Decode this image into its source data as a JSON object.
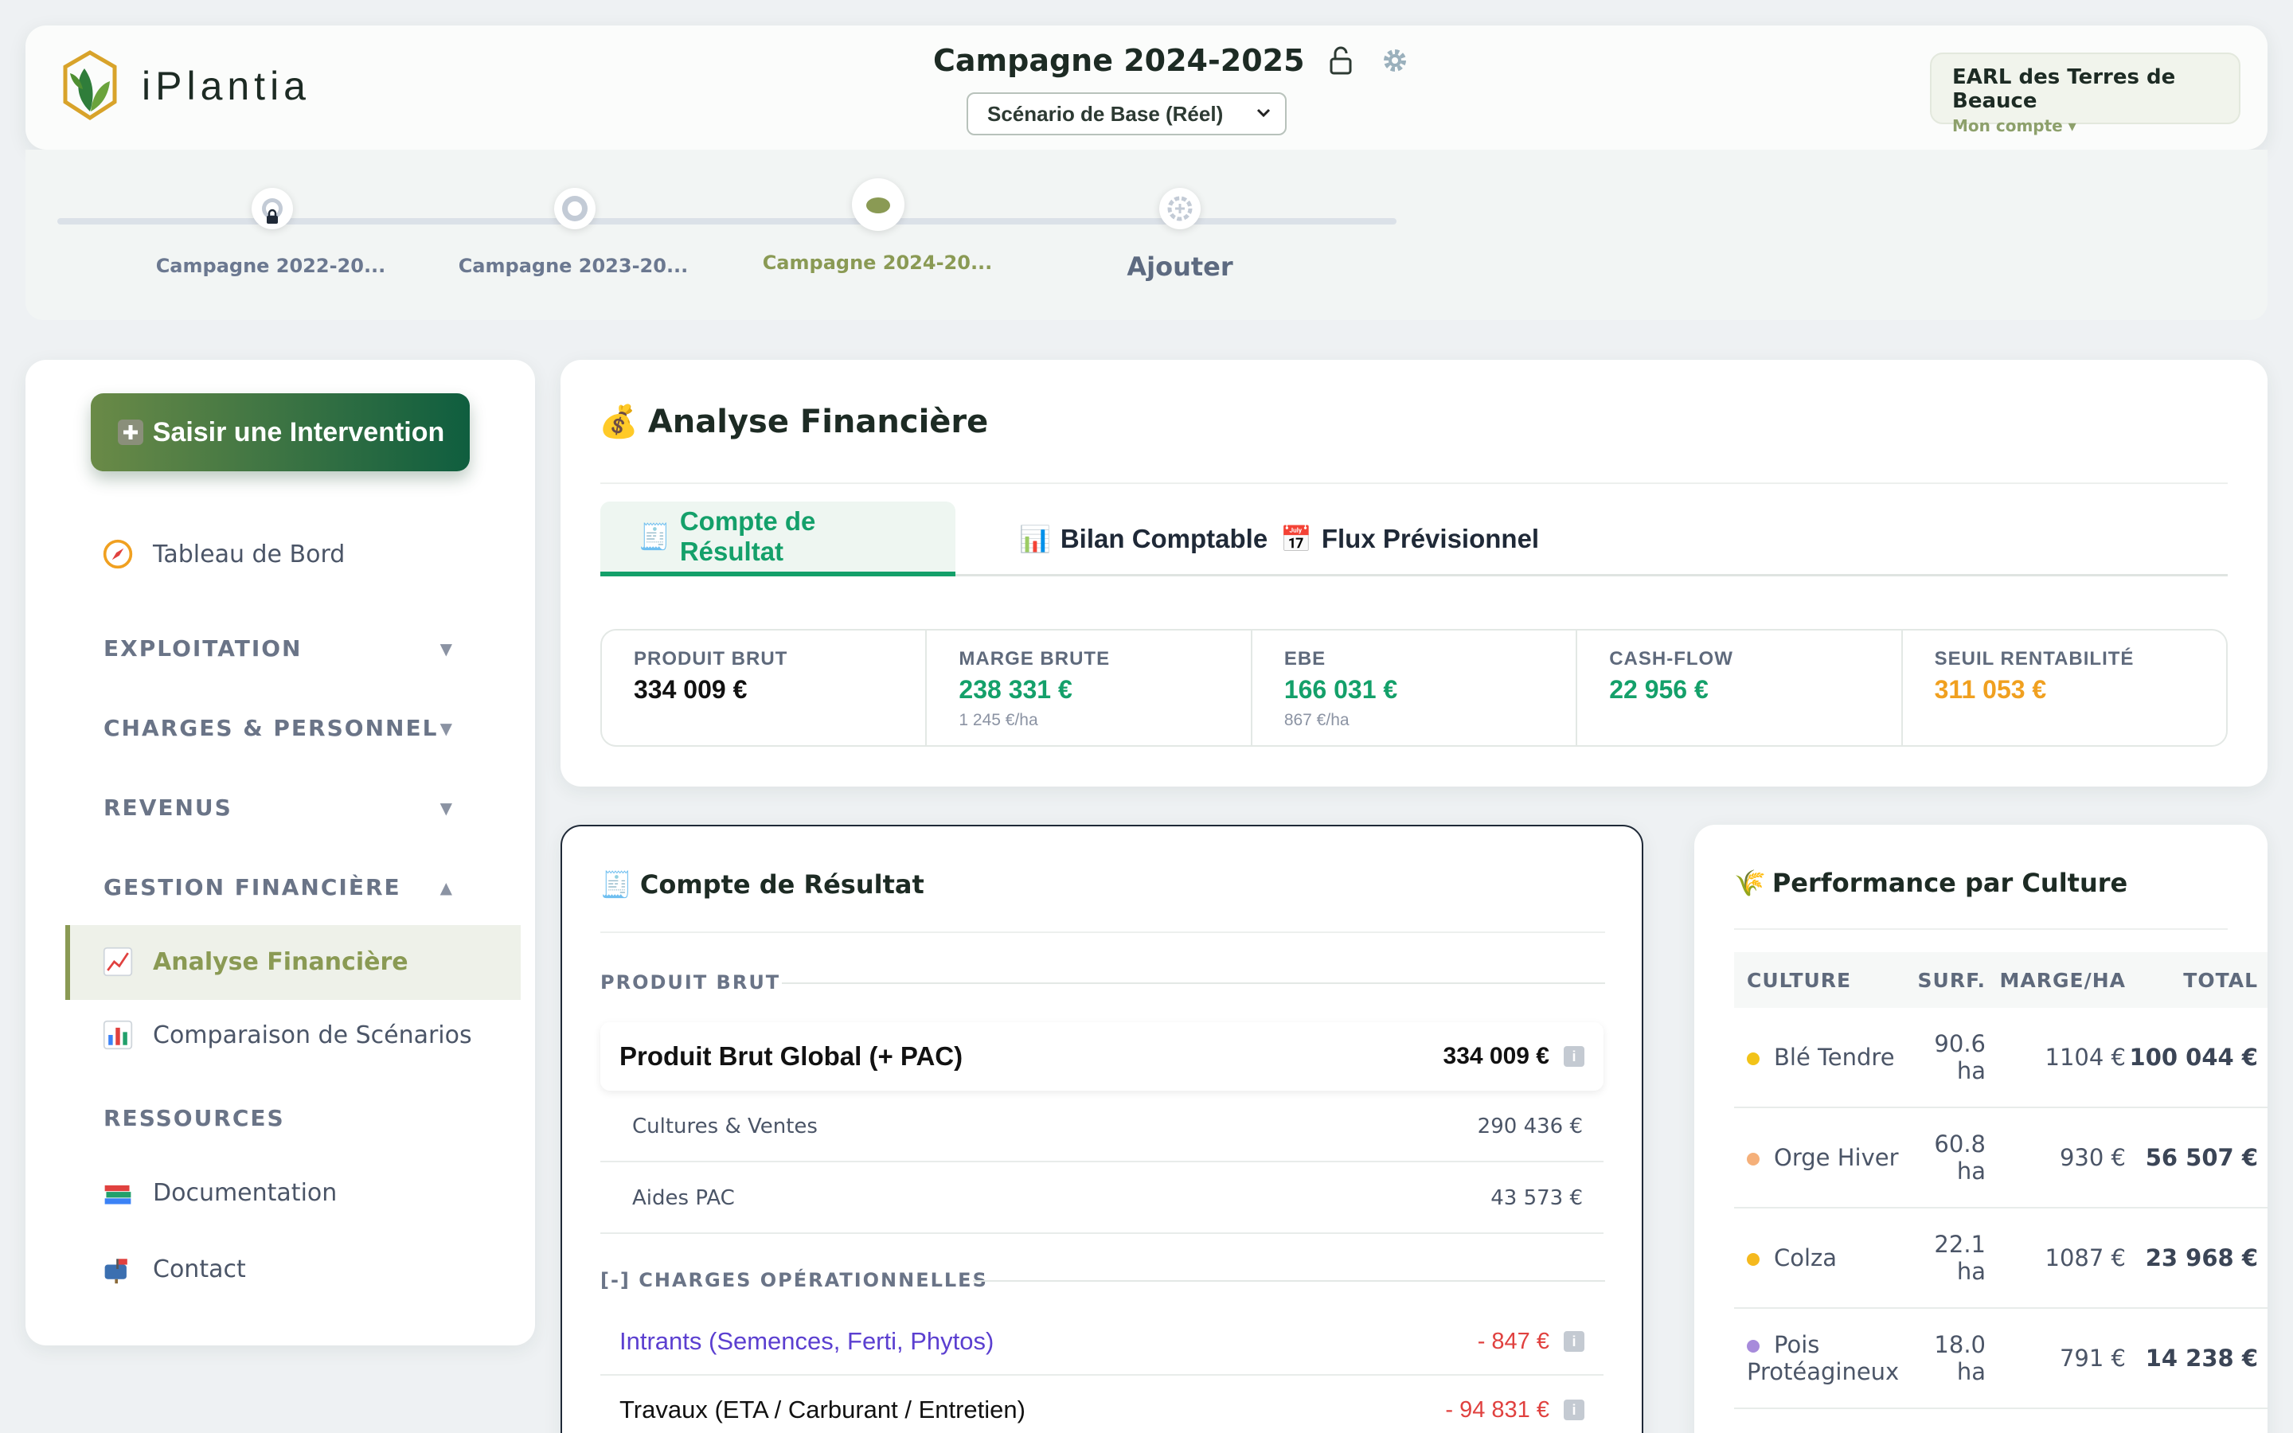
{
  "header": {
    "app_name": "iPlantia",
    "campaign_title": "Campagne 2024-2025",
    "scenario_selected": "Scénario de Base (Réel)",
    "account_name": "EARL des Terres de Beauce",
    "account_link": "Mon compte ▾"
  },
  "timeline": {
    "items": [
      {
        "label": "Campagne 2022-20..."
      },
      {
        "label": "Campagne 2023-20..."
      },
      {
        "label": "Campagne 2024-20..."
      },
      {
        "label": "Ajouter"
      }
    ]
  },
  "sidebar": {
    "cta_label": "Saisir une Intervention",
    "dashboard": "Tableau de Bord",
    "sections": [
      {
        "label": "EXPLOITATION",
        "arrow": "▼"
      },
      {
        "label": "CHARGES & PERSONNEL",
        "arrow": "▼"
      },
      {
        "label": "REVENUS",
        "arrow": "▼"
      },
      {
        "label": "GESTION FINANCIÈRE",
        "arrow": "▲"
      },
      {
        "label": "RESSOURCES"
      }
    ],
    "items": [
      {
        "label": "Analyse Financière"
      },
      {
        "label": "Comparaison de Scénarios"
      },
      {
        "label": "Documentation"
      },
      {
        "label": "Contact"
      }
    ]
  },
  "analysis": {
    "title": "Analyse Financière",
    "tabs": [
      {
        "label": "Compte de Résultat"
      },
      {
        "label": "Bilan Comptable"
      },
      {
        "label": "Flux Prévisionnel"
      }
    ],
    "kpis": [
      {
        "label": "PRODUIT BRUT",
        "value": "334 009 €",
        "sub": "",
        "color": "#111111"
      },
      {
        "label": "MARGE BRUTE",
        "value": "238 331 €",
        "sub": "1 245 €/ha",
        "color": "#14a06a"
      },
      {
        "label": "EBE",
        "value": "166 031 €",
        "sub": "867 €/ha",
        "color": "#14a06a"
      },
      {
        "label": "CASH-FLOW",
        "value": "22 956 €",
        "sub": "",
        "color": "#14a06a"
      },
      {
        "label": "SEUIL RENTABILITÉ",
        "value": "311 053 €",
        "sub": "",
        "color": "#f0a020"
      }
    ]
  },
  "income_statement": {
    "title": "Compte de Résultat",
    "section_revenue": "PRODUIT BRUT",
    "total_label": "Produit Brut Global (+ PAC)",
    "total_value": "334 009 €",
    "sub_rows": [
      {
        "label": "Cultures & Ventes",
        "value": "290 436 €"
      },
      {
        "label": "Aides PAC",
        "value": "43 573 €"
      }
    ],
    "section_charges": "[-] CHARGES OPÉRATIONNELLES",
    "charge_rows": [
      {
        "label": "Intrants (Semences, Ferti, Phytos)",
        "value": "- 847 €",
        "color": "#5b3fd0"
      },
      {
        "label": "Travaux (ETA / Carburant / Entretien)",
        "value": "- 94 831 €",
        "color": "#111111"
      }
    ]
  },
  "performance": {
    "title": "Performance par Culture",
    "headers": [
      "CULTURE",
      "SURF.",
      "MARGE/HA",
      "TOTAL"
    ],
    "rows": [
      {
        "culture": "Blé Tendre",
        "surface": "90.6 ha",
        "marge_ha": "1104 €",
        "total": "100 044 €",
        "color": "#f2c318"
      },
      {
        "culture": "Orge Hiver",
        "surface": "60.8 ha",
        "marge_ha": "930 €",
        "total": "56 507 €",
        "color": "#f5b07a"
      },
      {
        "culture": "Colza",
        "surface": "22.1 ha",
        "marge_ha": "1087 €",
        "total": "23 968 €",
        "color": "#f5b91e"
      },
      {
        "culture": "Pois Protéagineux",
        "surface": "18.0 ha",
        "marge_ha": "791 €",
        "total": "14 238 €",
        "color": "#a78bdb"
      }
    ]
  }
}
